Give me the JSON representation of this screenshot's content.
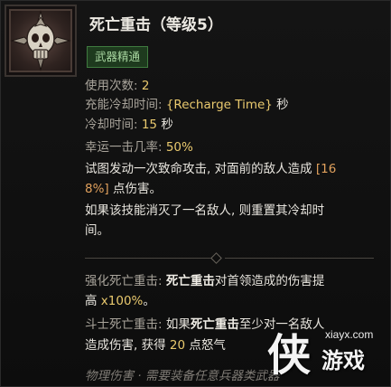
{
  "skill": {
    "title": "死亡重击（等级5）",
    "badge": "武器精通"
  },
  "stats": {
    "uses_label": "使用次数: ",
    "uses_value": "2",
    "recharge_label": "充能冷却时间: ",
    "recharge_value": "{Recharge Time}",
    "recharge_unit": " 秒",
    "cooldown_label": "冷却时间: ",
    "cooldown_value": "15",
    "cooldown_unit": " 秒",
    "luck_label": "幸运一击几率: ",
    "luck_value": "50%"
  },
  "description": {
    "line1_a": "试图发动一次致命攻击, 对面前的敌人造成 ",
    "line1_b": "[16",
    "line2_a": "8%]",
    "line2_b": " 点伤害。",
    "line3": "如果该技能消灭了一名敌人, 则重置其冷却时",
    "line4": "间。"
  },
  "enhance1": {
    "label": "强化死亡重击: ",
    "bold": "死亡重击",
    "text_a": "对首领造成的伤害提",
    "text_b": "高 ",
    "value": "x100%",
    "text_c": "。"
  },
  "enhance2": {
    "label": "斗士死亡重击: ",
    "text_a": "如果",
    "bold": "死亡重击",
    "text_b": "至少对一名敌人",
    "text_c": "造成伤害, 获得 ",
    "value": "20",
    "text_d": " 点怒气"
  },
  "footer": "物理伤害 · 需要装备任意兵器类武器",
  "watermark": {
    "char": "侠",
    "url": "xiayx.com",
    "name": "游戏"
  },
  "colors": {
    "highlight": "#e9c96e",
    "bracket": "#e0a05c",
    "badge_green": "#3f7b3f"
  }
}
